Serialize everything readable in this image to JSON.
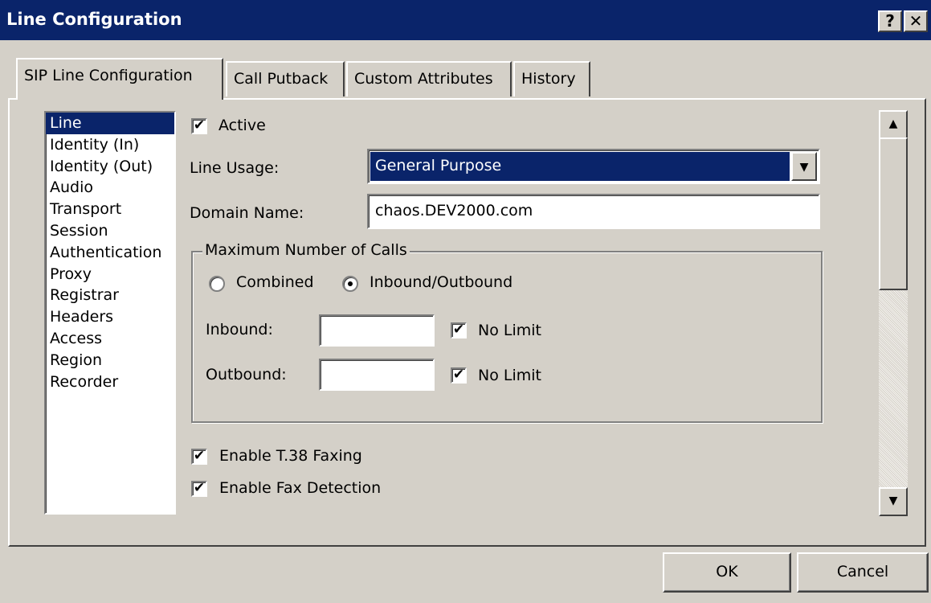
{
  "window": {
    "title": "Line Configuration",
    "help_button": "?",
    "close_button": "✕"
  },
  "tabs": [
    {
      "label": "SIP Line Configuration",
      "active": true
    },
    {
      "label": "Call Putback",
      "active": false
    },
    {
      "label": "Custom Attributes",
      "active": false
    },
    {
      "label": "History",
      "active": false
    }
  ],
  "sidebar": {
    "items": [
      {
        "label": "Line",
        "selected": true
      },
      {
        "label": "Identity (In)"
      },
      {
        "label": "Identity (Out)"
      },
      {
        "label": "Audio"
      },
      {
        "label": "Transport"
      },
      {
        "label": "Session"
      },
      {
        "label": "Authentication"
      },
      {
        "label": "Proxy"
      },
      {
        "label": "Registrar"
      },
      {
        "label": "Headers"
      },
      {
        "label": "Access"
      },
      {
        "label": "Region"
      },
      {
        "label": "Recorder"
      }
    ]
  },
  "form": {
    "active": {
      "label": "Active",
      "checked": true
    },
    "line_usage": {
      "label": "Line Usage:",
      "value": "General Purpose"
    },
    "domain_name": {
      "label": "Domain Name:",
      "value": "chaos.DEV2000.com"
    },
    "max_calls": {
      "title": "Maximum Number of Calls",
      "combined_label": "Combined",
      "inout_label": "Inbound/Outbound",
      "selected": "Inbound/Outbound",
      "inbound_label": "Inbound:",
      "inbound_value": "",
      "inbound_nolimit_label": "No Limit",
      "outbound_label": "Outbound:",
      "outbound_value": "",
      "outbound_nolimit_label": "No Limit"
    },
    "t38": {
      "label": "Enable T.38 Faxing",
      "checked": true
    },
    "fax_detect": {
      "label": "Enable Fax Detection",
      "checked": true
    }
  },
  "icons": {
    "check": "✔",
    "dropdown_arrow": "▼",
    "scroll_up": "▲",
    "scroll_down": "▼"
  },
  "buttons": {
    "ok": "OK",
    "cancel": "Cancel"
  },
  "colors": {
    "titlebar": "#0a246a",
    "selection": "#0a246a",
    "face": "#d4d0c8"
  }
}
